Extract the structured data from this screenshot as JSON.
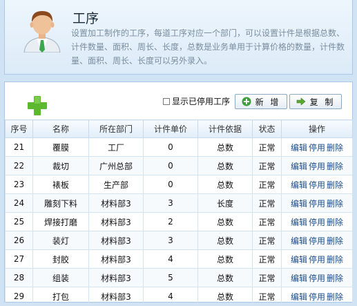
{
  "header": {
    "title": "工序",
    "description": "设置加工制作的工序，每道工序对应一个部门，可以设置计件是根据总数、计件数量、面积、周长、长度，总数是业务单用于计算价格的数量，计件数量、面积、周长、长度可以另外录入。"
  },
  "toolbar": {
    "show_disabled_label": "显示已停用工序",
    "show_disabled_checked": false,
    "new_label": "新 增",
    "copy_label": "复 制"
  },
  "table": {
    "columns": [
      "序号",
      "名称",
      "所在部门",
      "计件单价",
      "计件依据",
      "状态",
      "操作"
    ],
    "actions": [
      "编辑",
      "停用",
      "删除"
    ],
    "rows": [
      {
        "no": "21",
        "name": "覆膜",
        "dept": "工厂",
        "price": "0",
        "basis": "总数",
        "status": "正常"
      },
      {
        "no": "22",
        "name": "裁切",
        "dept": "广州总部",
        "price": "0",
        "basis": "总数",
        "status": "正常"
      },
      {
        "no": "23",
        "name": "裱板",
        "dept": "生产部",
        "price": "0",
        "basis": "总数",
        "status": "正常"
      },
      {
        "no": "24",
        "name": "雕刻下料",
        "dept": "材料部3",
        "price": "3",
        "basis": "长度",
        "status": "正常"
      },
      {
        "no": "25",
        "name": "焊接打磨",
        "dept": "材料部3",
        "price": "2",
        "basis": "总数",
        "status": "正常"
      },
      {
        "no": "26",
        "name": "装灯",
        "dept": "材料部3",
        "price": "3",
        "basis": "总数",
        "status": "正常"
      },
      {
        "no": "27",
        "name": "封胶",
        "dept": "材料部3",
        "price": "4",
        "basis": "总数",
        "status": "正常"
      },
      {
        "no": "28",
        "name": "组装",
        "dept": "材料部3",
        "price": "5",
        "basis": "总数",
        "status": "正常"
      },
      {
        "no": "29",
        "name": "打包",
        "dept": "材料部3",
        "price": "4",
        "basis": "总数",
        "status": "正常"
      }
    ]
  },
  "colors": {
    "background": "#cfe3f5",
    "link": "#1d4d8a",
    "add_icon": "#5cb82e"
  },
  "icons": {
    "avatar": "user-avatar-icon",
    "add": "plus-icon",
    "new": "plus-circle-icon",
    "copy": "arrow-right-icon"
  }
}
